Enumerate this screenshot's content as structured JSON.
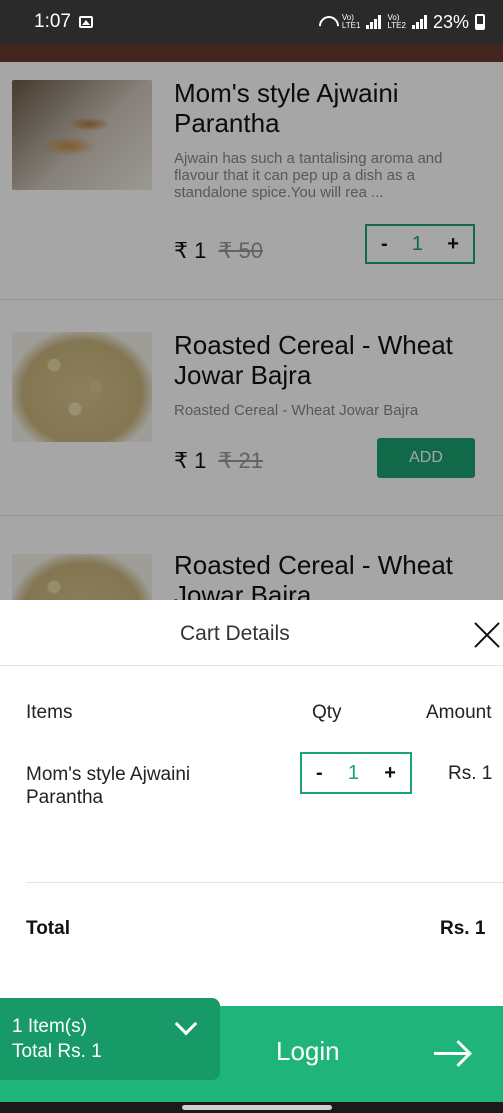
{
  "status_bar": {
    "time": "1:07",
    "battery": "23%",
    "lte1": "LTE1",
    "lte2": "LTE2"
  },
  "products": [
    {
      "title": "Mom's style Ajwaini Parantha",
      "description": "Ajwain has such a tantalising aroma and flavour that it can pep up a dish as a standalone spice.You will rea ...",
      "price": "₹ 1",
      "old_price": "₹ 50",
      "control": "stepper",
      "qty": "1",
      "minus": "-",
      "plus": "+"
    },
    {
      "title": "Roasted Cereal - Wheat Jowar Bajra",
      "description": "Roasted Cereal - Wheat Jowar Bajra",
      "price": "₹ 1",
      "old_price": "₹ 21",
      "control": "add",
      "add_label": "ADD"
    },
    {
      "title": "Roasted Cereal - Wheat Jowar Bajra"
    }
  ],
  "cart": {
    "title": "Cart Details",
    "columns": {
      "items": "Items",
      "qty": "Qty",
      "amount": "Amount"
    },
    "items": [
      {
        "name": "Mom's style Ajwaini Parantha",
        "qty": "1",
        "amount": "Rs. 1",
        "minus": "-",
        "plus": "+"
      }
    ],
    "total_label": "Total",
    "total_value": "Rs. 1"
  },
  "bottom_bar": {
    "item_count": "1 Item(s)",
    "total": "Total Rs. 1",
    "login_label": "Login"
  },
  "colors": {
    "accent_green": "#1aa470",
    "bar_green": "#1fb47a"
  }
}
